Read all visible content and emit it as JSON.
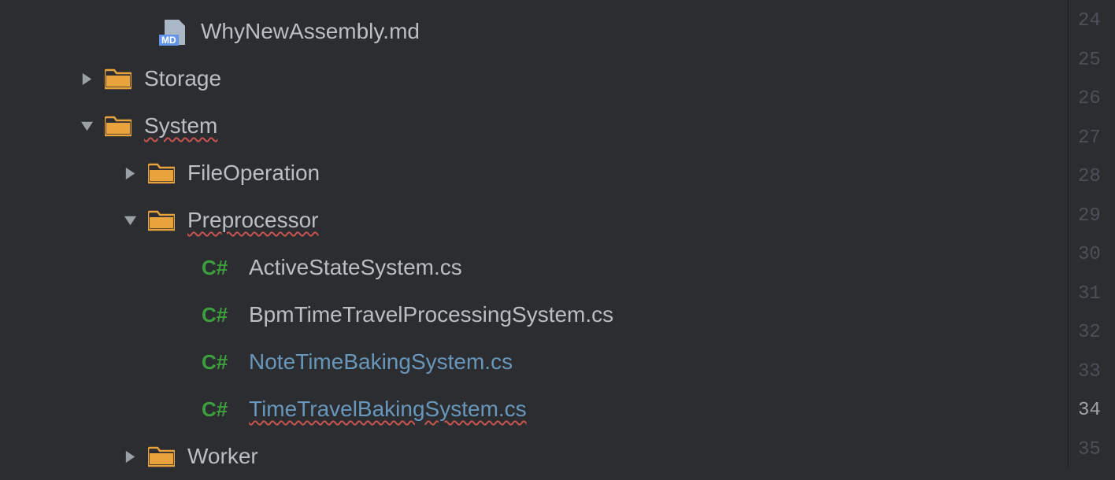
{
  "tree": {
    "file_whynewassembly": "WhyNewAssembly.md",
    "folder_storage": "Storage",
    "folder_system": "System",
    "folder_fileoperation": "FileOperation",
    "folder_preprocessor": "Preprocessor",
    "file_activestate": "ActiveStateSystem.cs",
    "file_bpmtimetravel": "BpmTimeTravelProcessingSystem.cs",
    "file_notetimebaking": "NoteTimeBakingSystem.cs",
    "file_timetravelbaking": "TimeTravelBakingSystem.cs",
    "folder_worker": "Worker"
  },
  "icons": {
    "md_badge": "MD",
    "cs_badge": "C#"
  },
  "gutter": {
    "lines": [
      "24",
      "25",
      "26",
      "27",
      "28",
      "29",
      "30",
      "31",
      "32",
      "33",
      "34",
      "35"
    ],
    "active": "34"
  }
}
